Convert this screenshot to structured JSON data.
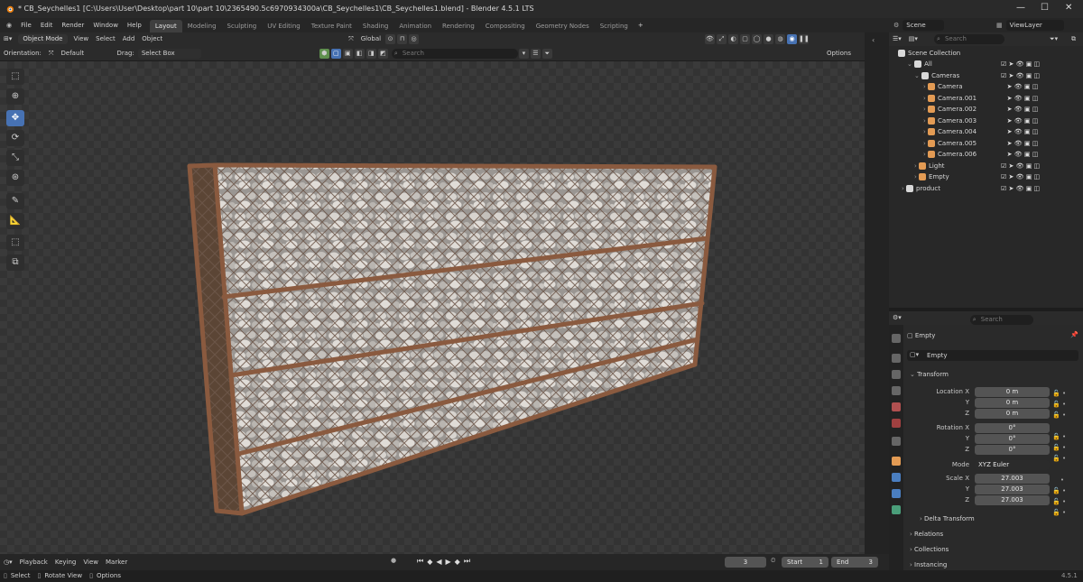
{
  "window": {
    "title": "* CB_Seychelles1 [C:\\Users\\User\\Desktop\\part 10\\part 10\\2365490.5c6970934300a\\CB_Seychelles1\\CB_Seychelles1.blend] - Blender 4.5.1 LTS",
    "minimize": "—",
    "maximize": "☐",
    "close": "✕"
  },
  "menu": [
    "File",
    "Edit",
    "Render",
    "Window",
    "Help"
  ],
  "workspaces": [
    "Layout",
    "Modeling",
    "Sculpting",
    "UV Editing",
    "Texture Paint",
    "Shading",
    "Animation",
    "Rendering",
    "Compositing",
    "Geometry Nodes",
    "Scripting"
  ],
  "workspace_add": "+",
  "scene": {
    "label": "Scene",
    "viewlayer": "ViewLayer"
  },
  "viewport_header": {
    "mode": "Object Mode",
    "menus": [
      "View",
      "Select",
      "Add",
      "Object"
    ],
    "transform_orientation": "Global"
  },
  "tool_settings": {
    "orientation_label": "Orientation:",
    "orientation_value": "Default",
    "drag_label": "Drag:",
    "drag_value": "Select Box",
    "search_placeholder": "Search",
    "options": "Options"
  },
  "toolbar_icons": [
    "cursor-select-icon",
    "cursor-icon",
    "move-icon",
    "rotate-icon",
    "scale-icon",
    "transform-icon",
    "annotate-icon",
    "measure-icon",
    "add-cube-icon",
    "add-object-icon"
  ],
  "outliner": {
    "search_placeholder": "Search",
    "items": [
      {
        "label": "Scene Collection",
        "level": 0,
        "kind": "collection"
      },
      {
        "label": "All",
        "level": 1,
        "kind": "collection"
      },
      {
        "label": "Cameras",
        "level": 2,
        "kind": "collection"
      },
      {
        "label": "Camera",
        "level": 3,
        "kind": "camera"
      },
      {
        "label": "Camera.001",
        "level": 3,
        "kind": "camera"
      },
      {
        "label": "Camera.002",
        "level": 3,
        "kind": "camera"
      },
      {
        "label": "Camera.003",
        "level": 3,
        "kind": "camera"
      },
      {
        "label": "Camera.004",
        "level": 3,
        "kind": "camera"
      },
      {
        "label": "Camera.005",
        "level": 3,
        "kind": "camera"
      },
      {
        "label": "Camera.006",
        "level": 3,
        "kind": "camera"
      },
      {
        "label": "Light",
        "level": 2,
        "kind": "light"
      },
      {
        "label": "Empty",
        "level": 2,
        "kind": "empty"
      },
      {
        "label": "product",
        "level": 1,
        "kind": "collection"
      }
    ]
  },
  "properties": {
    "search_placeholder": "Search",
    "object_name": "Empty",
    "data_name": "Empty",
    "transform_header": "Transform",
    "location_label": "Location X",
    "location": [
      "0 m",
      "0 m",
      "0 m"
    ],
    "rotation_label": "Rotation X",
    "rotation": [
      "0°",
      "0°",
      "0°"
    ],
    "mode_label": "Mode",
    "mode_value": "XYZ Euler",
    "scale_label": "Scale X",
    "scale": [
      "27.003",
      "27.003",
      "27.003"
    ],
    "axis_y": "Y",
    "axis_z": "Z",
    "sections": [
      "Delta Transform",
      "Relations",
      "Collections",
      "Instancing"
    ]
  },
  "timeline": {
    "menus": [
      "Playback",
      "Keying",
      "View",
      "Marker"
    ],
    "current_frame": "3",
    "start_label": "Start",
    "start_value": "1",
    "end_label": "End",
    "end_value": "3"
  },
  "statusbar": {
    "select": "Select",
    "rotate": "Rotate View",
    "options": "Options",
    "version": "4.5.1"
  },
  "colors": {
    "accent": "#4772b3",
    "frame_rust": "#8a5a3f",
    "stone": "#c8c4bf",
    "camera_icon": "#e39b54"
  }
}
